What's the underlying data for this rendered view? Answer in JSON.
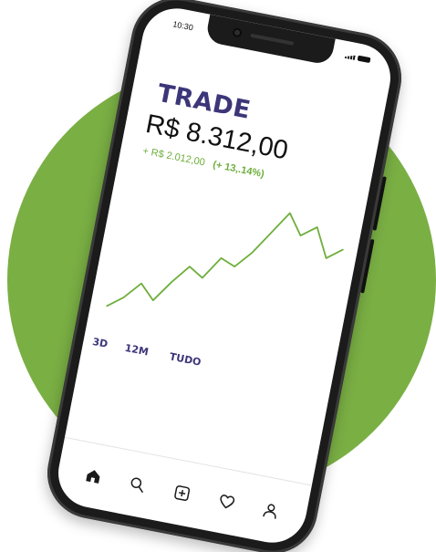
{
  "status_bar": {
    "time": "10:30",
    "icons": [
      "signal-icon",
      "battery-icon"
    ]
  },
  "trade": {
    "title": "TRADE",
    "value": "R$ 8.312,00",
    "change_amount": "+ R$ 2.012,00",
    "change_percent": "(+ 13,.14%)"
  },
  "chart_data": {
    "type": "line",
    "x": [
      0,
      1,
      2,
      3,
      4,
      5,
      6,
      7,
      8,
      9,
      10,
      11,
      12,
      13,
      14,
      15
    ],
    "series": [
      {
        "values": [
          10,
          18,
          30,
          20,
          35,
          48,
          42,
          58,
          54,
          66,
          82,
          98,
          84,
          92,
          72,
          80
        ]
      }
    ],
    "title": "",
    "xlabel": "",
    "ylabel": "",
    "ylim": [
      0,
      100
    ],
    "grid": false
  },
  "ranges": {
    "r1": "3D",
    "r2": "12M",
    "r3": "TUDO"
  },
  "tabbar": {
    "items": [
      "home-icon",
      "search-icon",
      "add-icon",
      "heart-icon",
      "profile-icon"
    ]
  },
  "colors": {
    "accent": "#3c3679",
    "positive": "#6fae3d",
    "background_circle": "#7aaf44",
    "phone_frame": "#1b1b1b"
  }
}
